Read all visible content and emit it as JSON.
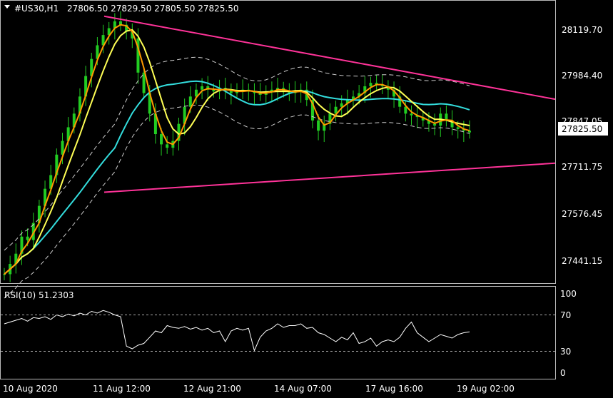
{
  "header": {
    "symbol": "#US30,H1",
    "ohlc": "27806.50 27829.50 27805.50 27825.50"
  },
  "colors": {
    "background": "#000000",
    "candle": "#22cc22",
    "ma_fast": "#ff9900",
    "ma_mid": "#ffff55",
    "ma_slow": "#33dddd",
    "trendline": "#ff3399",
    "envelope": "#cccccc",
    "price_tag_bg": "#ffffff",
    "price_tag_fg": "#000000"
  },
  "price_axis": {
    "labels": [
      "28119.70",
      "27984.40",
      "27847.05",
      "27711.75",
      "27576.45",
      "27441.15"
    ],
    "current_price": "27825.50"
  },
  "time_axis": {
    "labels": [
      "10 Aug 2020",
      "11 Aug 12:00",
      "12 Aug 21:00",
      "14 Aug 07:00",
      "17 Aug 16:00",
      "19 Aug 02:00"
    ]
  },
  "rsi": {
    "label": "RSI(10) 51.2303",
    "levels": [
      "100",
      "70",
      "30",
      "0"
    ]
  },
  "chart_data": {
    "type": "line",
    "title": "#US30,H1",
    "price_range": [
      27390,
      28200
    ],
    "trendlines": [
      {
        "name": "upper",
        "from": [
          0.0,
          28165
        ],
        "to": [
          1.0,
          27922
        ]
      },
      {
        "name": "lower",
        "from": [
          0.0,
          27650
        ],
        "to": [
          1.0,
          27735
        ]
      }
    ],
    "close_series": [
      27410,
      27440,
      27470,
      27520,
      27510,
      27560,
      27610,
      27660,
      27700,
      27760,
      27800,
      27840,
      27880,
      27930,
      27990,
      28040,
      28080,
      28110,
      28130,
      28150,
      28140,
      28120,
      28100,
      28000,
      27940,
      27880,
      27820,
      27790,
      27780,
      27800,
      27850,
      27900,
      27930,
      27950,
      27960,
      27950,
      27945,
      27955,
      27950,
      27940,
      27945,
      27950,
      27945,
      27940,
      27935,
      27945,
      27950,
      27955,
      27945,
      27940,
      27945,
      27950,
      27920,
      27860,
      27830,
      27850,
      27880,
      27900,
      27910,
      27920,
      27930,
      27940,
      27960,
      27970,
      27965,
      27960,
      27950,
      27930,
      27900,
      27880,
      27875,
      27870,
      27860,
      27850,
      27845,
      27880,
      27860,
      27840,
      27835,
      27830,
      27825
    ],
    "rsi_values": [
      60,
      62,
      64,
      66,
      63,
      67,
      66,
      68,
      65,
      70,
      68,
      71,
      69,
      72,
      70,
      74,
      72,
      75,
      73,
      70,
      68,
      35,
      32,
      36,
      38,
      45,
      52,
      50,
      58,
      56,
      55,
      57,
      54,
      56,
      53,
      55,
      50,
      52,
      40,
      52,
      55,
      53,
      55,
      30,
      45,
      52,
      55,
      60,
      56,
      58,
      58,
      60,
      55,
      56,
      50,
      48,
      44,
      40,
      45,
      42,
      50,
      38,
      40,
      44,
      35,
      40,
      42,
      40,
      45,
      55,
      62,
      50,
      45,
      40,
      44,
      48,
      46,
      44,
      48,
      50,
      51
    ]
  }
}
